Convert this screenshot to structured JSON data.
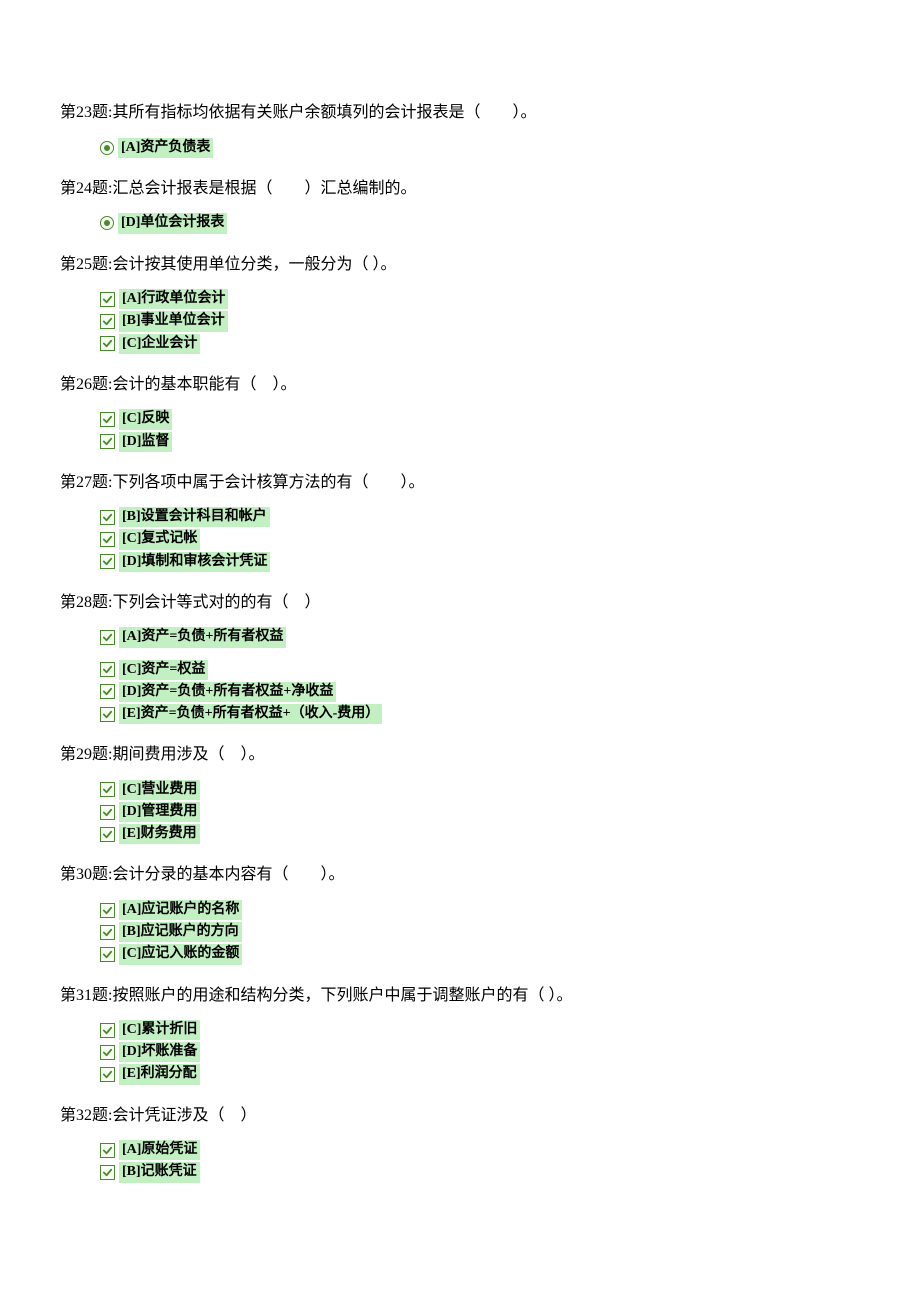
{
  "questions": [
    {
      "number": "第23题:",
      "text": "其所有指标均依据有关账户余额填列的会计报表是（　　）。",
      "type": "radio",
      "options": [
        {
          "label": "[A]资产负债表"
        }
      ]
    },
    {
      "number": "第24题:",
      "text": "汇总会计报表是根据（　　）汇总编制的。",
      "type": "radio",
      "options": [
        {
          "label": "[D]单位会计报表"
        }
      ]
    },
    {
      "number": "第25题:",
      "text": "会计按其使用单位分类，一般分为（ ）。",
      "type": "checkbox",
      "options": [
        {
          "label": "[A]行政单位会计"
        },
        {
          "label": "[B]事业单位会计"
        },
        {
          "label": "[C]企业会计"
        }
      ]
    },
    {
      "number": "第26题:",
      "text": "会计的基本职能有（　）。",
      "type": "checkbox",
      "options": [
        {
          "label": "[C]反映"
        },
        {
          "label": "[D]监督"
        }
      ]
    },
    {
      "number": "第27题:",
      "text": "下列各项中属于会计核算方法的有（　　）。",
      "type": "checkbox",
      "options": [
        {
          "label": "[B]设置会计科目和帐户"
        },
        {
          "label": "[C]复式记帐"
        },
        {
          "label": "[D]填制和审核会计凭证"
        }
      ]
    },
    {
      "number": "第28题:",
      "text": "下列会计等式对的的有（　）",
      "type": "checkbox",
      "options_group1": [
        {
          "label": "[A]资产=负债+所有者权益"
        }
      ],
      "options_group2": [
        {
          "label": "[C]资产=权益"
        },
        {
          "label": "[D]资产=负债+所有者权益+净收益"
        },
        {
          "label": "[E]资产=负债+所有者权益+（收入-费用）"
        }
      ]
    },
    {
      "number": "第29题:",
      "text": "期间费用涉及（　）。",
      "type": "checkbox",
      "options": [
        {
          "label": "[C]营业费用"
        },
        {
          "label": "[D]管理费用"
        },
        {
          "label": "[E]财务费用"
        }
      ]
    },
    {
      "number": "第30题:",
      "text": "会计分录的基本内容有（　　）。",
      "type": "checkbox",
      "options": [
        {
          "label": "[A]应记账户的名称"
        },
        {
          "label": "[B]应记账户的方向"
        },
        {
          "label": "[C]应记入账的金额"
        }
      ]
    },
    {
      "number": "第31题:",
      "text": "按照账户的用途和结构分类，下列账户中属于调整账户的有（ ）。",
      "type": "checkbox",
      "options": [
        {
          "label": "[C]累计折旧"
        },
        {
          "label": "[D]坏账准备"
        },
        {
          "label": "[E]利润分配"
        }
      ]
    },
    {
      "number": "第32题:",
      "text": "会计凭证涉及（　）",
      "type": "checkbox",
      "options": [
        {
          "label": "[A]原始凭证"
        },
        {
          "label": "[B]记账凭证"
        }
      ]
    }
  ]
}
